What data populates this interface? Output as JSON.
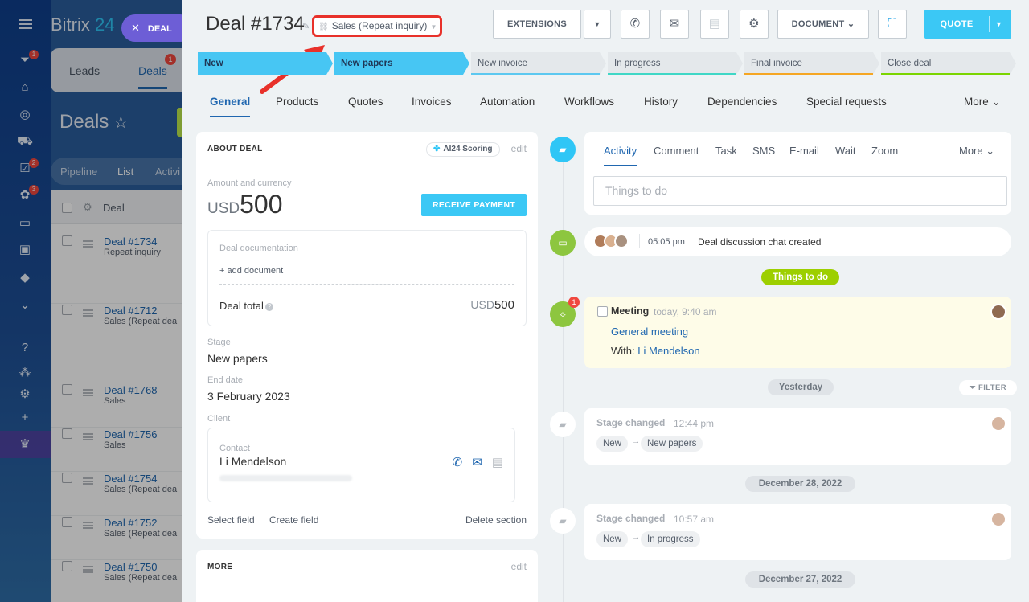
{
  "app": {
    "brand_name": "Bitrix",
    "brand_num": "24",
    "deal_pill": "DEAL",
    "deal_pill_close": "✕"
  },
  "sidebar": {
    "badges": {
      "crm": "1",
      "tasks": "2",
      "sites": "3"
    }
  },
  "background": {
    "tabs": [
      {
        "label": "Leads"
      },
      {
        "label": "Deals"
      }
    ],
    "deals_badge": "1",
    "page_title": "Deals",
    "views": [
      {
        "label": "Pipeline"
      },
      {
        "label": "List"
      },
      {
        "label": "Activi"
      }
    ],
    "column_header": "Deal",
    "rows": [
      {
        "title": "Deal #1734",
        "subtitle": "Repeat inquiry"
      },
      {
        "title": "Deal #1712",
        "subtitle": "Sales (Repeat dea"
      },
      {
        "title": "Deal #1768",
        "subtitle": "Sales"
      },
      {
        "title": "Deal #1756",
        "subtitle": "Sales"
      },
      {
        "title": "Deal #1754",
        "subtitle": "Sales (Repeat dea"
      },
      {
        "title": "Deal #1752",
        "subtitle": "Sales (Repeat dea"
      },
      {
        "title": "Deal #1750",
        "subtitle": "Sales (Repeat dea"
      }
    ]
  },
  "header": {
    "title": "Deal #1734",
    "category": "Sales (Repeat inquiry)",
    "extensions_label": "EXTENSIONS",
    "document_label": "DOCUMENT",
    "quote_label": "QUOTE"
  },
  "stages": [
    {
      "label": "New",
      "state": "done",
      "color": "#47c6f3"
    },
    {
      "label": "New papers",
      "state": "done",
      "color": "#47c6f3"
    },
    {
      "label": "New invoice",
      "state": "todo",
      "color": "#5cc8f0"
    },
    {
      "label": "In progress",
      "state": "todo",
      "color": "#3fd7c6"
    },
    {
      "label": "Final invoice",
      "state": "todo",
      "color": "#f5a623"
    },
    {
      "label": "Close deal",
      "state": "todo",
      "color": "#7bd500"
    }
  ],
  "tabs": [
    {
      "label": "General",
      "active": true
    },
    {
      "label": "Products"
    },
    {
      "label": "Quotes"
    },
    {
      "label": "Invoices"
    },
    {
      "label": "Automation"
    },
    {
      "label": "Workflows"
    },
    {
      "label": "History"
    },
    {
      "label": "Dependencies"
    },
    {
      "label": "Special requests"
    },
    {
      "label": "More"
    }
  ],
  "about": {
    "section_title": "ABOUT DEAL",
    "ai_scoring": "AI24 Scoring",
    "edit": "edit",
    "amount_label": "Amount and currency",
    "currency": "USD",
    "amount": "500",
    "receive_payment": "RECEIVE PAYMENT",
    "doc_label": "Deal documentation",
    "add_document": "+ add document",
    "deal_total_label": "Deal total",
    "deal_total_currency": "USD",
    "deal_total_amount": "500",
    "stage_label": "Stage",
    "stage_value": "New papers",
    "end_date_label": "End date",
    "end_date_value": "3 February 2023",
    "client_label": "Client",
    "contact_label": "Contact",
    "contact_name": "Li Mendelson",
    "select_field": "Select field",
    "create_field": "Create field",
    "delete_section": "Delete section"
  },
  "more_section": {
    "title": "MORE",
    "edit": "edit"
  },
  "activity": {
    "tabs": [
      {
        "label": "Activity",
        "active": true
      },
      {
        "label": "Comment"
      },
      {
        "label": "Task"
      },
      {
        "label": "SMS"
      },
      {
        "label": "E-mail"
      },
      {
        "label": "Wait"
      },
      {
        "label": "Zoom"
      },
      {
        "label": "More"
      }
    ],
    "placeholder": "Things to do"
  },
  "timeline": {
    "chat_time": "05:05 pm",
    "chat_text": "Deal discussion chat created",
    "things_to_do": "Things to do",
    "meeting": {
      "badge": "1",
      "title": "Meeting",
      "time": "today, 9:40 am",
      "subject": "General meeting",
      "with_label": "With:",
      "with_name": "Li Mendelson"
    },
    "yesterday": "Yesterday",
    "filter": "FILTER",
    "changes": [
      {
        "title": "Stage changed",
        "time": "12:44 pm",
        "from": "New",
        "to": "New papers"
      },
      {
        "title": "Stage changed",
        "time": "10:57 am",
        "from": "New",
        "to": "In progress"
      }
    ],
    "dates": [
      "December 28, 2022",
      "December 27, 2022"
    ]
  }
}
